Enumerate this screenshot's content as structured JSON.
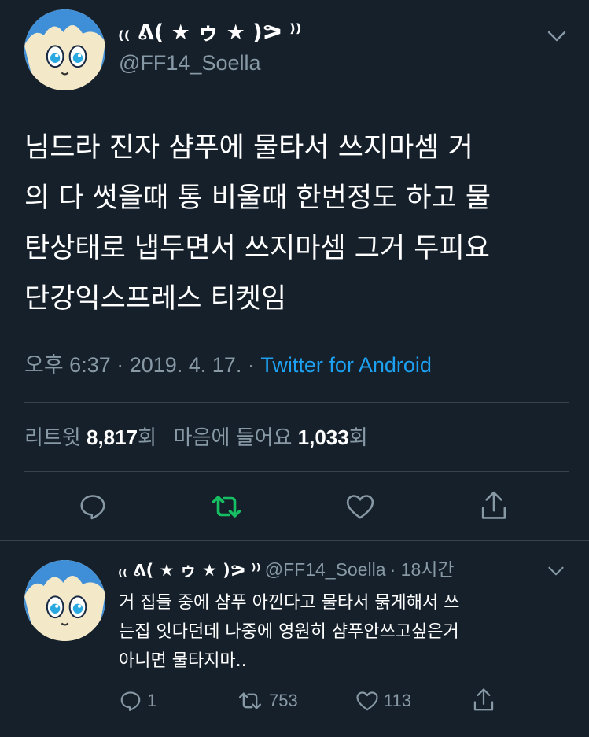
{
  "tweet": {
    "display_name": "₍₍ ᕕ( ★ ゥ ★ )ᕗ ⁾⁾",
    "handle": "@FF14_Soella",
    "text_lines": [
      "님드라 진자 샴푸에 물타서 쓰지마셈 거",
      "의 다 썻을때 통 비울때 한번정도 하고 물",
      "탄상태로 냅두면서 쓰지마셈 그거 두피요",
      "단강익스프레스 티켓임"
    ],
    "timestamp": "오후 6:37 · 2019. 4. 17. · ",
    "source": "Twitter for Android",
    "stats": {
      "retweets_label": "리트윗",
      "retweets_count": "8,817",
      "retweets_unit": "회",
      "likes_label": "마음에 들어요",
      "likes_count": "1,033",
      "likes_unit": "회"
    },
    "actions": {
      "reply_icon": "reply-icon",
      "retweet_icon": "retweet-icon",
      "like_icon": "heart-icon",
      "share_icon": "share-icon",
      "retweet_color": "#17bf63"
    }
  },
  "reply": {
    "display_name": "₍₍ ᕕ( ★ ゥ ★ )ᕗ ⁾⁾",
    "handle": "@FF14_Soella",
    "time": "· 18시간",
    "text_lines": [
      "거 집들 중에 샴푸 아낀다고 물타서 묽게해서 쓰",
      "는집 잇다던데 나중에 영원히 샴푸안쓰고싶은거",
      "아니면 물타지마.."
    ],
    "reply_count": "1",
    "retweet_count": "753",
    "like_count": "113"
  },
  "colors": {
    "background": "#15202b",
    "divider": "#38444d",
    "secondary_text": "#8899a6",
    "link": "#1da1f2",
    "retweet_active": "#17bf63"
  }
}
